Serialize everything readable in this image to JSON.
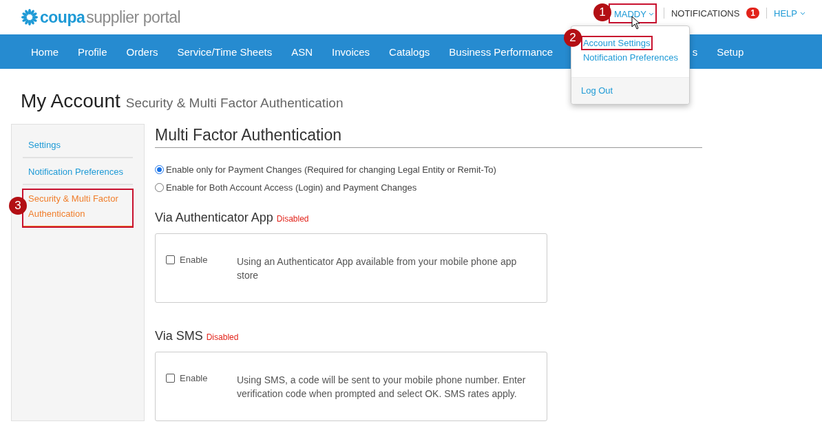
{
  "header": {
    "logo": {
      "brand": "coupa",
      "product": "supplier portal"
    },
    "user_menu": {
      "label": "MADDY",
      "expanded": true,
      "annotation": "1",
      "items": [
        {
          "label": "Account Settings",
          "kind": "link",
          "annotation": "2"
        },
        {
          "label": "Notification Preferences",
          "kind": "link"
        },
        {
          "label": "Log Out",
          "kind": "footer"
        }
      ]
    },
    "notifications": {
      "label": "NOTIFICATIONS",
      "count": "1"
    },
    "help": {
      "label": "HELP"
    }
  },
  "nav": [
    {
      "label": "Home",
      "kind": "item"
    },
    {
      "label": "Profile",
      "kind": "item"
    },
    {
      "label": "Orders",
      "kind": "item"
    },
    {
      "label": "Service/Time Sheets",
      "kind": "item"
    },
    {
      "label": "ASN",
      "kind": "item"
    },
    {
      "label": "Invoices",
      "kind": "item"
    },
    {
      "label": "Catalogs",
      "kind": "item"
    },
    {
      "label": "Business Performance",
      "kind": "item"
    },
    {
      "label": "s",
      "kind": "covered"
    },
    {
      "label": "Setup",
      "kind": "item"
    }
  ],
  "page": {
    "title": "My Account",
    "subtitle": "Security & Multi Factor Authentication"
  },
  "sidebar": [
    {
      "label": "Settings",
      "selected": false
    },
    {
      "label": "Notification Preferences",
      "selected": false
    },
    {
      "label": "Security & Multi Factor Authentication",
      "selected": true,
      "annotation": "3"
    }
  ],
  "mfa": {
    "title": "Multi Factor Authentication",
    "options": [
      {
        "label": "Enable only for Payment Changes (Required for changing Legal Entity or Remit-To)",
        "selected": true
      },
      {
        "label": "Enable for Both Account Access (Login) and Payment Changes",
        "selected": false
      }
    ],
    "methods": [
      {
        "title": "Via Authenticator App",
        "status": "Disabled",
        "enable_label": "Enable",
        "checked": false,
        "description": "Using an Authenticator App available from your mobile phone app store"
      },
      {
        "title": "Via SMS",
        "status": "Disabled",
        "enable_label": "Enable",
        "checked": false,
        "description": "Using SMS, a code will be sent to your mobile phone number. Enter verification code when prompted and select OK. SMS rates apply."
      }
    ]
  }
}
